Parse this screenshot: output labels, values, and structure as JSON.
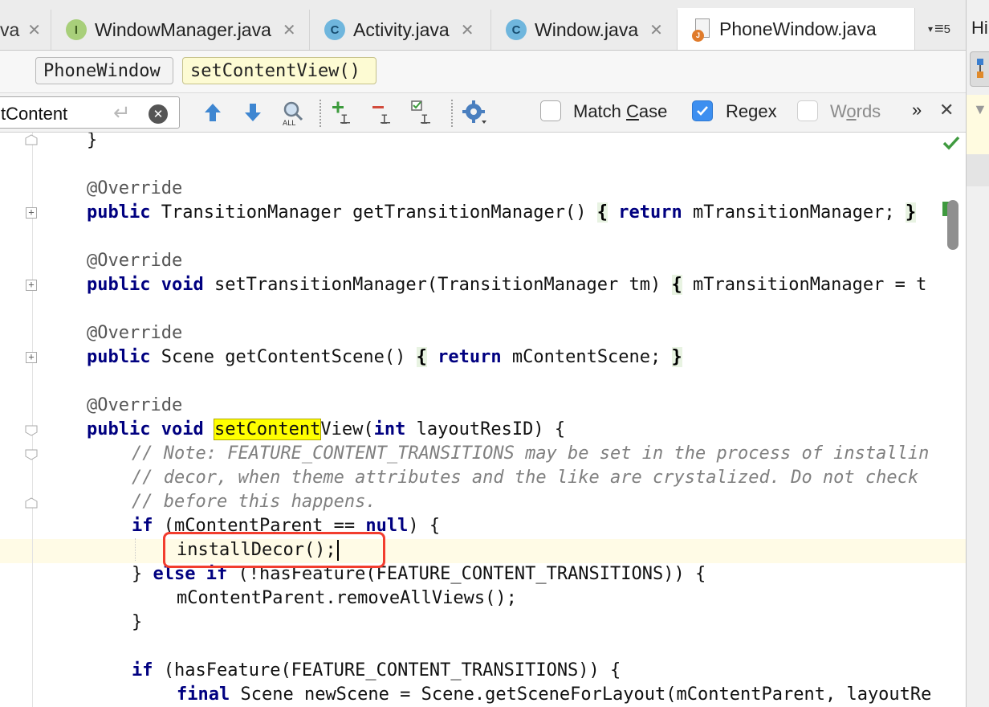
{
  "tabs": [
    {
      "label": "va",
      "icon": "none",
      "active": false
    },
    {
      "label": "WindowManager.java",
      "icon": "I",
      "active": false
    },
    {
      "label": "Activity.java",
      "icon": "C",
      "active": false
    },
    {
      "label": "Window.java",
      "icon": "C",
      "active": false
    },
    {
      "label": "PhoneWindow.java",
      "icon": "J",
      "active": true
    }
  ],
  "tab_overflow": {
    "count": "5"
  },
  "right_panel": {
    "title": "Hi"
  },
  "breadcrumb": [
    "PhoneWindow",
    "setContentView()"
  ],
  "search": {
    "query": "tContent",
    "options": [
      {
        "label_pre": "Match ",
        "label_u": "C",
        "label_post": "ase",
        "checked": false
      },
      {
        "label_pre": "Re",
        "label_u": "g",
        "label_post": "ex",
        "checked": true
      },
      {
        "label_pre": "W",
        "label_u": "o",
        "label_post": "rds",
        "checked": false
      }
    ],
    "more": "»",
    "close": "✕"
  },
  "code": {
    "l1": "}",
    "l3": "@Override",
    "l4_kw": "public",
    "l4_a": " TransitionManager getTransitionManager() ",
    "l4_b": "{",
    "l4_c": " ",
    "l4_kw2": "return",
    "l4_d": " mTransitionManager; ",
    "l4_e": "}",
    "l6": "@Override",
    "l7_kw": "public void",
    "l7_a": " setTransitionManager(TransitionManager tm) ",
    "l7_b": "{",
    "l7_c": " mTransitionManager = t",
    "l9": "@Override",
    "l10_kw": "public",
    "l10_a": " Scene getContentScene() ",
    "l10_b": "{",
    "l10_c": " ",
    "l10_kw2": "return",
    "l10_d": " mContentScene; ",
    "l10_e": "}",
    "l12": "@Override",
    "l13_kw": "public void",
    "l13_sp": " ",
    "l13_hl": "setContent",
    "l13_a": "View(",
    "l13_kw2": "int",
    "l13_b": " layoutResID) {",
    "l14": "// Note: FEATURE_CONTENT_TRANSITIONS may be set in the process of installin",
    "l15": "// decor, when theme attributes and the like are crystalized. Do not check",
    "l16": "// before this happens.",
    "l17_kw": "if",
    "l17_a": " (mContentParent == ",
    "l17_kw2": "null",
    "l17_b": ") {",
    "l18": "installDecor();",
    "l19_a": "} ",
    "l19_kw": "else if",
    "l19_b": " (!hasFeature(FEATURE_CONTENT_TRANSITIONS)) {",
    "l20": "mContentParent.removeAllViews();",
    "l21": "}",
    "l23_kw": "if",
    "l23_a": " (hasFeature(FEATURE_CONTENT_TRANSITIONS)) {",
    "l24_kw": "final",
    "l24_a": " Scene newScene = Scene.getSceneForLayout(mContentParent, layoutRe"
  },
  "colors": {
    "keyword": "#000080",
    "comment": "#808080",
    "match_highlight": "#ffff00",
    "annotation_box": "#f23d2e",
    "caret_row": "#fffbe6",
    "checkbox_on": "#3d8ff0"
  }
}
